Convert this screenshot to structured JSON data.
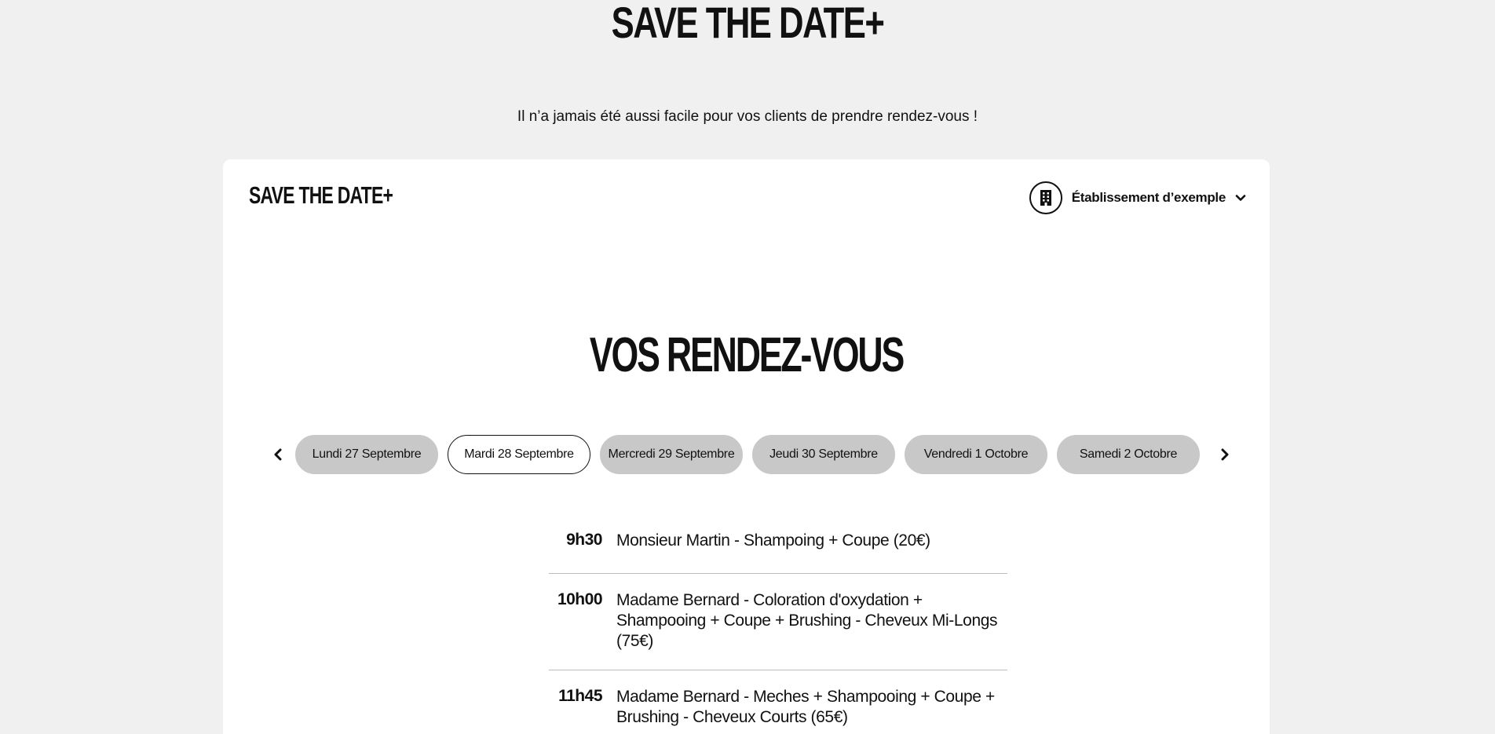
{
  "hero": {
    "title": "SAVE THE DATE+",
    "subtitle": "Il n’a jamais été aussi facile pour vos clients de prendre rendez-vous !"
  },
  "card": {
    "logo": "SAVE THE DATE+",
    "establishment": {
      "label": "Établissement d’exemple",
      "icon": "building-icon",
      "dropdown_icon": "chevron-down-icon"
    },
    "section_title": "VOS RENDEZ-VOUS",
    "days": [
      {
        "label": "Lundi 27 Septembre",
        "active": false
      },
      {
        "label": "Mardi 28 Septembre",
        "active": true
      },
      {
        "label": "Mercredi 29 Septembre",
        "active": false
      },
      {
        "label": "Jeudi 30 Septembre",
        "active": false
      },
      {
        "label": "Vendredi 1 Octobre",
        "active": false
      },
      {
        "label": "Samedi 2 Octobre",
        "active": false
      }
    ],
    "appointments": [
      {
        "time": "9h30",
        "description": "Monsieur Martin -  Shampoing + Coupe (20€)"
      },
      {
        "time": "10h00",
        "description": "Madame Bernard - Coloration d'oxydation + Shampooing + Coupe + Brushing - Cheveux Mi-Longs (75€)"
      },
      {
        "time": "11h45",
        "description": "Madame Bernard - Meches + Shampooing + Coupe + Brushing - Cheveux Courts (65€)"
      }
    ]
  },
  "colors": {
    "page_background": "#f0f0f0",
    "card_background": "#ffffff",
    "pill_inactive": "#c8c8c8",
    "pill_active_border": "#111111",
    "divider": "#bdbdbd"
  }
}
